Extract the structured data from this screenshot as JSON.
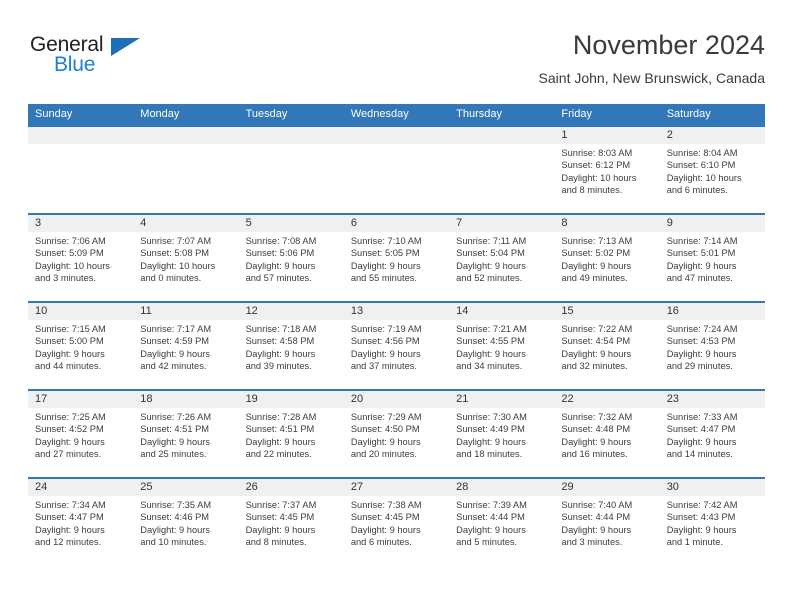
{
  "brand": {
    "name_part1": "General",
    "name_part2": "Blue",
    "triangle_icon": "triangle-icon",
    "accent_color": "#1d6fb8"
  },
  "header": {
    "title": "November 2024",
    "subtitle": "Saint John, New Brunswick, Canada"
  },
  "colors": {
    "header_blue": "#3277b8",
    "day_band_gray": "#f0f0f0",
    "text": "#3d3d3d"
  },
  "weekdays": [
    "Sunday",
    "Monday",
    "Tuesday",
    "Wednesday",
    "Thursday",
    "Friday",
    "Saturday"
  ],
  "labels": {
    "sunrise": "Sunrise:",
    "sunset": "Sunset:",
    "daylight": "Daylight:"
  },
  "weeks": [
    [
      {
        "day": "",
        "sunrise": "",
        "sunset": "",
        "daylight_1": "",
        "daylight_2": ""
      },
      {
        "day": "",
        "sunrise": "",
        "sunset": "",
        "daylight_1": "",
        "daylight_2": ""
      },
      {
        "day": "",
        "sunrise": "",
        "sunset": "",
        "daylight_1": "",
        "daylight_2": ""
      },
      {
        "day": "",
        "sunrise": "",
        "sunset": "",
        "daylight_1": "",
        "daylight_2": ""
      },
      {
        "day": "",
        "sunrise": "",
        "sunset": "",
        "daylight_1": "",
        "daylight_2": ""
      },
      {
        "day": "1",
        "sunrise": "Sunrise: 8:03 AM",
        "sunset": "Sunset: 6:12 PM",
        "daylight_1": "Daylight: 10 hours",
        "daylight_2": "and 8 minutes."
      },
      {
        "day": "2",
        "sunrise": "Sunrise: 8:04 AM",
        "sunset": "Sunset: 6:10 PM",
        "daylight_1": "Daylight: 10 hours",
        "daylight_2": "and 6 minutes."
      }
    ],
    [
      {
        "day": "3",
        "sunrise": "Sunrise: 7:06 AM",
        "sunset": "Sunset: 5:09 PM",
        "daylight_1": "Daylight: 10 hours",
        "daylight_2": "and 3 minutes."
      },
      {
        "day": "4",
        "sunrise": "Sunrise: 7:07 AM",
        "sunset": "Sunset: 5:08 PM",
        "daylight_1": "Daylight: 10 hours",
        "daylight_2": "and 0 minutes."
      },
      {
        "day": "5",
        "sunrise": "Sunrise: 7:08 AM",
        "sunset": "Sunset: 5:06 PM",
        "daylight_1": "Daylight: 9 hours",
        "daylight_2": "and 57 minutes."
      },
      {
        "day": "6",
        "sunrise": "Sunrise: 7:10 AM",
        "sunset": "Sunset: 5:05 PM",
        "daylight_1": "Daylight: 9 hours",
        "daylight_2": "and 55 minutes."
      },
      {
        "day": "7",
        "sunrise": "Sunrise: 7:11 AM",
        "sunset": "Sunset: 5:04 PM",
        "daylight_1": "Daylight: 9 hours",
        "daylight_2": "and 52 minutes."
      },
      {
        "day": "8",
        "sunrise": "Sunrise: 7:13 AM",
        "sunset": "Sunset: 5:02 PM",
        "daylight_1": "Daylight: 9 hours",
        "daylight_2": "and 49 minutes."
      },
      {
        "day": "9",
        "sunrise": "Sunrise: 7:14 AM",
        "sunset": "Sunset: 5:01 PM",
        "daylight_1": "Daylight: 9 hours",
        "daylight_2": "and 47 minutes."
      }
    ],
    [
      {
        "day": "10",
        "sunrise": "Sunrise: 7:15 AM",
        "sunset": "Sunset: 5:00 PM",
        "daylight_1": "Daylight: 9 hours",
        "daylight_2": "and 44 minutes."
      },
      {
        "day": "11",
        "sunrise": "Sunrise: 7:17 AM",
        "sunset": "Sunset: 4:59 PM",
        "daylight_1": "Daylight: 9 hours",
        "daylight_2": "and 42 minutes."
      },
      {
        "day": "12",
        "sunrise": "Sunrise: 7:18 AM",
        "sunset": "Sunset: 4:58 PM",
        "daylight_1": "Daylight: 9 hours",
        "daylight_2": "and 39 minutes."
      },
      {
        "day": "13",
        "sunrise": "Sunrise: 7:19 AM",
        "sunset": "Sunset: 4:56 PM",
        "daylight_1": "Daylight: 9 hours",
        "daylight_2": "and 37 minutes."
      },
      {
        "day": "14",
        "sunrise": "Sunrise: 7:21 AM",
        "sunset": "Sunset: 4:55 PM",
        "daylight_1": "Daylight: 9 hours",
        "daylight_2": "and 34 minutes."
      },
      {
        "day": "15",
        "sunrise": "Sunrise: 7:22 AM",
        "sunset": "Sunset: 4:54 PM",
        "daylight_1": "Daylight: 9 hours",
        "daylight_2": "and 32 minutes."
      },
      {
        "day": "16",
        "sunrise": "Sunrise: 7:24 AM",
        "sunset": "Sunset: 4:53 PM",
        "daylight_1": "Daylight: 9 hours",
        "daylight_2": "and 29 minutes."
      }
    ],
    [
      {
        "day": "17",
        "sunrise": "Sunrise: 7:25 AM",
        "sunset": "Sunset: 4:52 PM",
        "daylight_1": "Daylight: 9 hours",
        "daylight_2": "and 27 minutes."
      },
      {
        "day": "18",
        "sunrise": "Sunrise: 7:26 AM",
        "sunset": "Sunset: 4:51 PM",
        "daylight_1": "Daylight: 9 hours",
        "daylight_2": "and 25 minutes."
      },
      {
        "day": "19",
        "sunrise": "Sunrise: 7:28 AM",
        "sunset": "Sunset: 4:51 PM",
        "daylight_1": "Daylight: 9 hours",
        "daylight_2": "and 22 minutes."
      },
      {
        "day": "20",
        "sunrise": "Sunrise: 7:29 AM",
        "sunset": "Sunset: 4:50 PM",
        "daylight_1": "Daylight: 9 hours",
        "daylight_2": "and 20 minutes."
      },
      {
        "day": "21",
        "sunrise": "Sunrise: 7:30 AM",
        "sunset": "Sunset: 4:49 PM",
        "daylight_1": "Daylight: 9 hours",
        "daylight_2": "and 18 minutes."
      },
      {
        "day": "22",
        "sunrise": "Sunrise: 7:32 AM",
        "sunset": "Sunset: 4:48 PM",
        "daylight_1": "Daylight: 9 hours",
        "daylight_2": "and 16 minutes."
      },
      {
        "day": "23",
        "sunrise": "Sunrise: 7:33 AM",
        "sunset": "Sunset: 4:47 PM",
        "daylight_1": "Daylight: 9 hours",
        "daylight_2": "and 14 minutes."
      }
    ],
    [
      {
        "day": "24",
        "sunrise": "Sunrise: 7:34 AM",
        "sunset": "Sunset: 4:47 PM",
        "daylight_1": "Daylight: 9 hours",
        "daylight_2": "and 12 minutes."
      },
      {
        "day": "25",
        "sunrise": "Sunrise: 7:35 AM",
        "sunset": "Sunset: 4:46 PM",
        "daylight_1": "Daylight: 9 hours",
        "daylight_2": "and 10 minutes."
      },
      {
        "day": "26",
        "sunrise": "Sunrise: 7:37 AM",
        "sunset": "Sunset: 4:45 PM",
        "daylight_1": "Daylight: 9 hours",
        "daylight_2": "and 8 minutes."
      },
      {
        "day": "27",
        "sunrise": "Sunrise: 7:38 AM",
        "sunset": "Sunset: 4:45 PM",
        "daylight_1": "Daylight: 9 hours",
        "daylight_2": "and 6 minutes."
      },
      {
        "day": "28",
        "sunrise": "Sunrise: 7:39 AM",
        "sunset": "Sunset: 4:44 PM",
        "daylight_1": "Daylight: 9 hours",
        "daylight_2": "and 5 minutes."
      },
      {
        "day": "29",
        "sunrise": "Sunrise: 7:40 AM",
        "sunset": "Sunset: 4:44 PM",
        "daylight_1": "Daylight: 9 hours",
        "daylight_2": "and 3 minutes."
      },
      {
        "day": "30",
        "sunrise": "Sunrise: 7:42 AM",
        "sunset": "Sunset: 4:43 PM",
        "daylight_1": "Daylight: 9 hours",
        "daylight_2": "and 1 minute."
      }
    ]
  ]
}
